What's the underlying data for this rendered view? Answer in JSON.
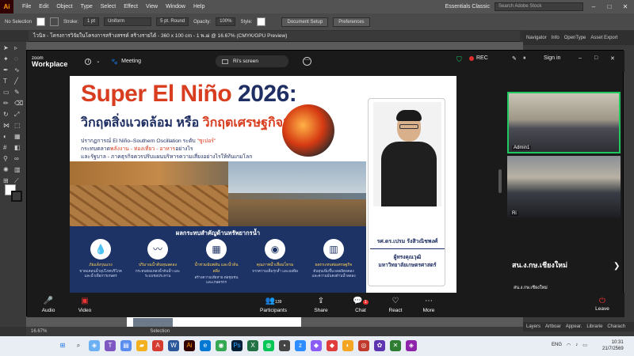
{
  "ai": {
    "logo": "Ai",
    "menu": [
      "File",
      "Edit",
      "Object",
      "Type",
      "Select",
      "Effect",
      "View",
      "Window",
      "Help"
    ],
    "workspace": "Essentials Classic",
    "search_placeholder": "Search Adobe Stock",
    "control": {
      "selection": "No Selection",
      "stroke_label": "Stroke:",
      "stroke_value": "1 pt",
      "profile": "Uniform",
      "brush": "5 pt. Round",
      "opacity_label": "Opacity:",
      "opacity_value": "100%",
      "style_label": "Style:",
      "doc_setup": "Document Setup",
      "preferences": "Preferences"
    },
    "doc_tab": "ไวนิล - โครงการวิจัยในโครงการสร้างสรรค์ สร้างรายได้ - 360 x 100 cm - 1 พ.ai @ 16.67% (CMYK/GPU Preview)",
    "right_tabs": [
      "Navigator",
      "Info",
      "OpenType",
      "Asset Export"
    ],
    "right_bottom_tabs": [
      "Layers",
      "Artboar",
      "Appear.",
      "Librarie",
      "Charach"
    ],
    "status_zoom": "16.67%",
    "status_tool": "Selection"
  },
  "zoom": {
    "logo_top": "zoom",
    "logo_bottom": "Workplace",
    "meeting_label": "Meeting",
    "screen_share": "Ri's screen",
    "rec_label": "REC",
    "sign_in": "Sign in",
    "tiles": [
      {
        "label": "Admin1"
      },
      {
        "label": "Ri"
      },
      {
        "label": "สน.ง.กษ.เชียงใหม่"
      }
    ],
    "self_label": "สน.ง.กษ.เชียงใหม่",
    "participants_count": "139",
    "chat_badge": "1",
    "toolbar": [
      "Audio",
      "Video",
      "Participants",
      "Share",
      "Chat",
      "React",
      "More"
    ],
    "leave": "Leave"
  },
  "slide": {
    "title_a": "Super El Niño",
    "title_b": " 2026:",
    "subtitle_a": "วิกฤตสิ่งแวดล้อม หรือ ",
    "subtitle_b": "วิกฤตเศรษฐกิจ?",
    "bullet1_a": "ปรากฏการณ์ El Niño–Southern Oscillation ระดับ ",
    "bullet1_b": "\"ซูเปอร์\"",
    "bullet2_a": "กระทบตลาด",
    "bullet2_b": "พลังงาน - ท่องเที่ยว - อาหาร",
    "bullet2_c": "อย่างไร",
    "bullet3": "และรัฐบาล - ภาคธุรกิจควรปรับแผนบริหารความเสี่ยงอย่างไรให้ทันเกมโลก",
    "impact_title": "ผลกระทบสำคัญด้านทรัพยากรน้ำ",
    "impacts": [
      {
        "icon": "💧",
        "head": "ภัยแล้งรุนแรง",
        "desc": "ขาดแคลนน้ำอุปโภคบริโภค และน้ำเพื่อการเกษตร"
      },
      {
        "icon": "〰",
        "head": "ปริมาณน้ำต้นทุนลดลง",
        "desc": "กระทบต่อแหล่งน้ำต้นน้ำ และระบบชลประทาน"
      },
      {
        "icon": "▦",
        "head": "น้ำท่วมฉับพลัน และน้ำล้นตลิ่ง",
        "desc": "สร้างความเสียหาย ต่อชุมชนและเกษตรกร"
      },
      {
        "icon": "◉",
        "head": "คุณภาพน้ำเสื่อมโทรม",
        "desc": "จากความเค็มรุกล้ำ และมลพิษ"
      },
      {
        "icon": "▥",
        "head": "ผลกระทบต่อเศรษฐกิจ",
        "desc": "ต้นทุนเพิ่มขึ้น ผลผลิตลดลง และความมั่นคงด้านน้ำลดลง"
      }
    ],
    "speaker_name": "รศ.ดร.เปรม รังสิวณิชพงศ์",
    "speaker_role_1": "ผู้ทรงคุณวุฒิ",
    "speaker_role_2": "มหาวิทยาลัยเกษตรศาสตร์"
  },
  "taskbar": {
    "lang": "ENG",
    "time": "10:31",
    "date": "21/7/2569"
  },
  "colors": {
    "zoom_bg": "#1a1a1a",
    "active_speaker": "#1fc95f",
    "rec_red": "#e02e2e",
    "slide_red": "#d83d1f",
    "slide_navy": "#1f2f63"
  }
}
